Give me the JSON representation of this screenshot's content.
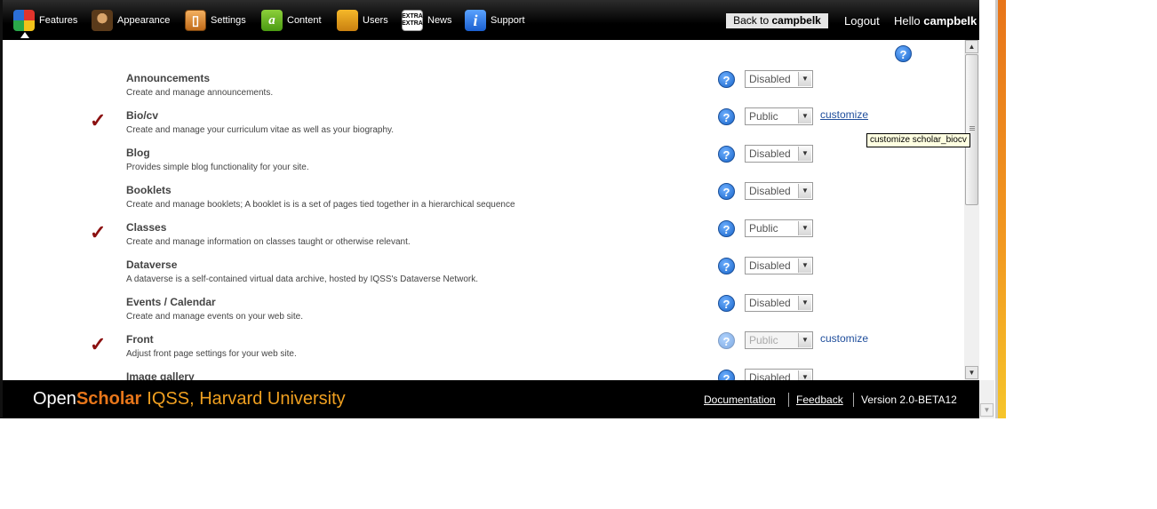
{
  "nav": {
    "items": [
      {
        "label": "Features"
      },
      {
        "label": "Appearance"
      },
      {
        "label": "Settings"
      },
      {
        "label": "Content"
      },
      {
        "label": "Users"
      },
      {
        "label": "News"
      },
      {
        "label": "Support"
      }
    ],
    "back_prefix": "Back to",
    "back_user": "campbelk",
    "logout": "Logout",
    "hello_prefix": "Hello",
    "hello_user": "campbelk"
  },
  "help_glyph": "?",
  "features": [
    {
      "title": "Announcements",
      "desc": "Create and manage announcements.",
      "status": "Disabled",
      "enabled": false,
      "customize": ""
    },
    {
      "title": "Bio/cv",
      "desc": "Create and manage your curriculum vitae as well as your biography.",
      "status": "Public",
      "enabled": true,
      "customize": "customize"
    },
    {
      "title": "Blog",
      "desc": "Provides simple blog functionality for your site.",
      "status": "Disabled",
      "enabled": false,
      "customize": ""
    },
    {
      "title": "Booklets",
      "desc": "Create and manage booklets; A booklet is is a set of pages tied together in a hierarchical sequence",
      "status": "Disabled",
      "enabled": false,
      "customize": ""
    },
    {
      "title": "Classes",
      "desc": "Create and manage information on classes taught or otherwise relevant.",
      "status": "Public",
      "enabled": true,
      "customize": ""
    },
    {
      "title": "Dataverse",
      "desc": "A dataverse is a self-contained virtual data archive, hosted by IQSS's Dataverse Network.",
      "status": "Disabled",
      "enabled": false,
      "customize": ""
    },
    {
      "title": "Events / Calendar",
      "desc": "Create and manage events on your web site.",
      "status": "Disabled",
      "enabled": false,
      "customize": ""
    },
    {
      "title": "Front",
      "desc": "Adjust front page settings for your web site.",
      "status": "Public",
      "enabled": true,
      "customize": "customize",
      "locked": true
    },
    {
      "title": "Image gallery",
      "desc": "",
      "status": "Disabled",
      "enabled": false,
      "customize": ""
    }
  ],
  "tooltip": "customize scholar_biocv",
  "footer": {
    "brand_open": "Open",
    "brand_scholar": "Scholar",
    "brand_org": "IQSS, Harvard University",
    "documentation": "Documentation",
    "feedback": "Feedback",
    "version": "Version 2.0-BETA12"
  },
  "colors": {
    "accent_orange": "#e8761a",
    "check_red": "#8b1010",
    "link_blue": "#1f4e9c"
  }
}
